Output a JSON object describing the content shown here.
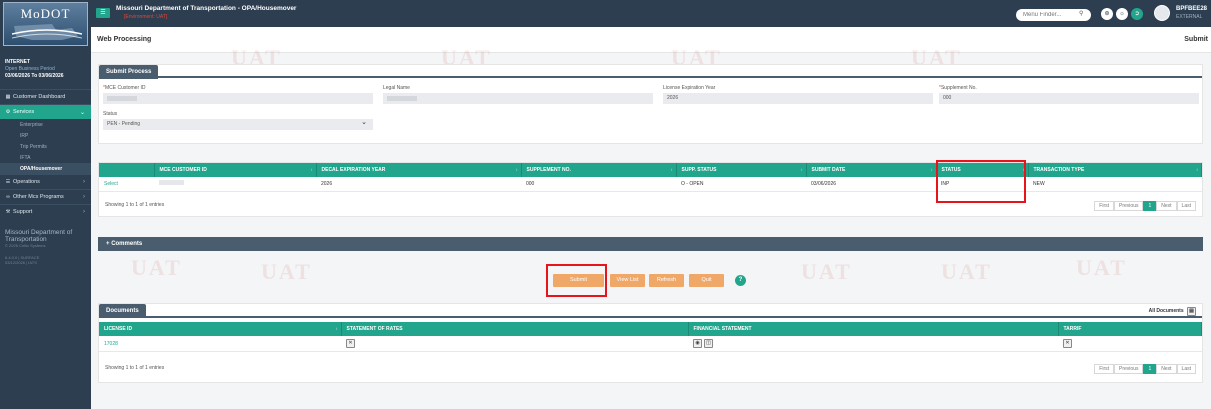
{
  "sidebar": {
    "logo_text": "MoDOT",
    "network": "INTERNET",
    "period_label": "Open Business Period",
    "period_dates": "03/06/2026 To 03/06/2026",
    "items": [
      {
        "icon": "grid-icon",
        "label": "Customer Dashboard"
      },
      {
        "icon": "gear-icon",
        "label": "Services"
      },
      {
        "icon": "list-icon",
        "label": "Operations"
      },
      {
        "icon": "link-icon",
        "label": "Other Mcs Programs"
      },
      {
        "icon": "wrench-icon",
        "label": "Support"
      }
    ],
    "service_subitems": [
      "Enterprise",
      "IRP",
      "Trip Permits",
      "IFTA",
      "OPA/Housemover"
    ],
    "footer_org": "Missouri Department of Transportation",
    "footer_vendor": "© 2026 Celtic Systems",
    "footer_version": "6.4.0.0 | SURFACE",
    "footer_build": "03/12/2026 | IATS"
  },
  "topbar": {
    "title": "Missouri Department of Transportation - OPA/Housemover",
    "environment": "[Environment: UAT]",
    "menu_finder_placeholder": "Menu Finder...",
    "user_id": "BPFBEE28",
    "user_type": "EXTERNAL"
  },
  "page": {
    "title": "Web Processing",
    "action": "Submit",
    "watermark": "UAT"
  },
  "submit_process": {
    "tab": "Submit Process",
    "fields": {
      "customer_id_label": "MCE Customer ID",
      "legal_name_label": "Legal Name",
      "license_year_label": "License Expiration Year",
      "license_year_value": "2026",
      "supplement_label": "Supplement No.",
      "supplement_value": "000",
      "status_label": "Status",
      "status_value": "PEN - Pending"
    }
  },
  "supplement_table": {
    "headers": [
      "",
      "MCE CUSTOMER ID",
      "DECAL EXPIRATION YEAR",
      "SUPPLEMENT NO.",
      "SUPP. STATUS",
      "SUBMIT DATE",
      "STATUS",
      "TRANSACTION TYPE"
    ],
    "rows": [
      {
        "select": "Select",
        "customer_id": "",
        "decal_year": "2026",
        "supplement": "000",
        "supp_status": "O - OPEN",
        "submit_date": "03/06/2026",
        "status": "INP",
        "transaction_type": "NEW"
      }
    ],
    "showing": "Showing 1 to 1 of 1 entries",
    "pager": [
      "First",
      "Previous",
      "1",
      "Next",
      "Last"
    ]
  },
  "comments": {
    "label": "Comments"
  },
  "actions": {
    "submit": "Submit",
    "view_list": "View List",
    "refresh": "Refresh",
    "quit": "Quit",
    "info": "?"
  },
  "documents": {
    "tab": "Documents",
    "all_documents": "All Documents",
    "headers": [
      "LICENSE ID",
      "STATEMENT OF RATES",
      "FINANCIAL STATEMENT",
      "TARRIF"
    ],
    "rows": [
      {
        "license_id": "17028"
      }
    ],
    "showing": "Showing 1 to 1 of 1 entries",
    "pager": [
      "First",
      "Previous",
      "1",
      "Next",
      "Last"
    ]
  },
  "colors": {
    "nav_bg": "#2c3e50",
    "accent": "#21a68d",
    "action_button": "#f0a868",
    "highlight_box": "#e8141b",
    "environment_text": "#e2453a"
  }
}
